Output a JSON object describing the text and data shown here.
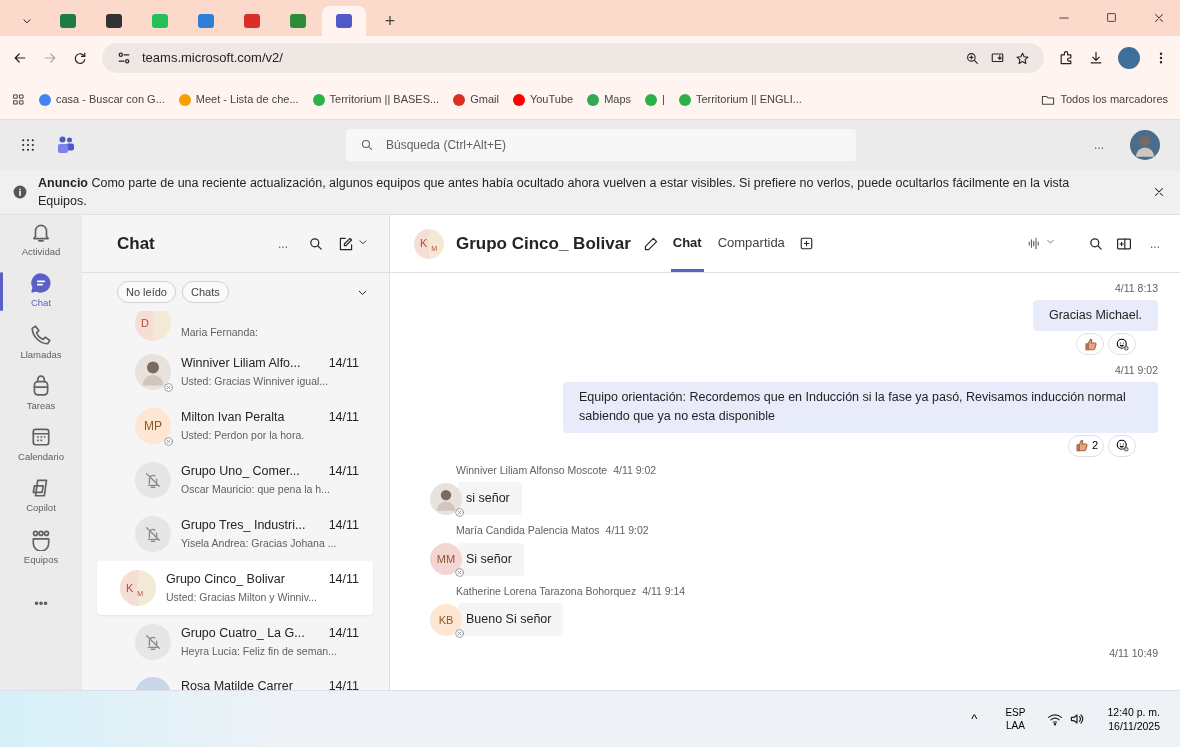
{
  "browser": {
    "tabs": [
      {
        "color": "#1e7b45",
        "selected": false
      },
      {
        "color": "#333333",
        "selected": false
      },
      {
        "color": "#25c05a",
        "selected": false
      },
      {
        "color": "#2f7fd8",
        "selected": false
      },
      {
        "color": "#d93025",
        "selected": false
      },
      {
        "color": "#2e8b3a",
        "selected": false
      },
      {
        "color": "#5059c9",
        "selected": true
      }
    ],
    "new_tab": "+",
    "address": "teams.microsoft.com/v2/",
    "bookmarks": [
      {
        "label": "casa - Buscar con G...",
        "color": "#4285f4"
      },
      {
        "label": "Meet - Lista de che...",
        "color": "#f4a100"
      },
      {
        "label": "Territorium || BASES...",
        "color": "#2db24a"
      },
      {
        "label": "Gmail",
        "color": "#d93025"
      },
      {
        "label": "YouTube",
        "color": "#ff0000"
      },
      {
        "label": "Maps",
        "color": "#34a853"
      },
      {
        "label": "|",
        "color": "#2db24a"
      },
      {
        "label": "Territorium || ENGLI...",
        "color": "#2db24a"
      }
    ],
    "all_bookmarks": "Todos los marcadores"
  },
  "teams": {
    "search": {
      "placeholder": "Búsqueda (Ctrl+Alt+E)"
    },
    "more": "...",
    "banner": {
      "title": "Anuncio",
      "text": "Como parte de una reciente actualización, algunos equipos que antes había ocultado ahora vuelven a estar visibles. Si prefiere no verlos, puede ocultarlos fácilmente en la vista Equipos."
    },
    "rail": [
      {
        "label": "Actividad",
        "kind": "bell",
        "selected": false
      },
      {
        "label": "Chat",
        "kind": "chat",
        "selected": true
      },
      {
        "label": "Llamadas",
        "kind": "phone",
        "selected": false
      },
      {
        "label": "Tareas",
        "kind": "bag",
        "selected": false
      },
      {
        "label": "Calendario",
        "kind": "calendar",
        "selected": false
      },
      {
        "label": "Copilot",
        "kind": "copilot",
        "selected": false
      },
      {
        "label": "Equipos",
        "kind": "teams",
        "selected": false
      }
    ],
    "rail_more": "•••",
    "chat_list": {
      "title": "Chat",
      "more": "...",
      "filters": [
        "No leído",
        "Chats"
      ],
      "items": [
        {
          "avatar": {
            "kind": "group",
            "initials": "D"
          },
          "preview": "Maria Fernanda:",
          "selected": false
        },
        {
          "avatar": {
            "kind": "photo"
          },
          "name": "Winniver Liliam Alfo...",
          "time": "14/11",
          "preview": "Usted: Gracias Winniver igual...",
          "selected": false
        },
        {
          "avatar": {
            "kind": "initials",
            "initials": "MP"
          },
          "name": "Milton Ivan Peralta",
          "time": "14/11",
          "preview": "Usted: Perdon por la hora.",
          "selected": false
        },
        {
          "avatar": {
            "kind": "muted"
          },
          "name": "Grupo Uno_ Comer...",
          "time": "14/11",
          "preview": "Oscar Mauricio: que pena la h...",
          "selected": false
        },
        {
          "avatar": {
            "kind": "muted"
          },
          "name": "Grupo Tres_ Industri...",
          "time": "14/11",
          "preview": "Yisela Andrea: Gracias Johana ...",
          "selected": false
        },
        {
          "avatar": {
            "kind": "group",
            "initials": "K",
            "initials2": "M"
          },
          "name": "Grupo Cinco_ Bolivar",
          "time": "14/11",
          "preview": "Usted: Gracias Milton y Winniv...",
          "selected": true
        },
        {
          "avatar": {
            "kind": "muted"
          },
          "name": "Grupo Cuatro_ La G...",
          "time": "14/11",
          "preview": "Heyra Lucia: Feliz fin de seman...",
          "selected": false
        },
        {
          "avatar": {
            "kind": "blank"
          },
          "name": "Rosa Matilde Carrer",
          "time": "14/11",
          "selected": false
        }
      ]
    },
    "conversation": {
      "initials": "K",
      "initials2": "M",
      "title": "Grupo Cinco_ Bolivar",
      "tabs": [
        {
          "label": "Chat",
          "selected": true
        },
        {
          "label": "Compartida",
          "selected": false
        }
      ],
      "messages": [
        {
          "kind": "outgoing",
          "time": "4/11 8:13",
          "text": "Gracias Michael."
        },
        {
          "kind": "outgoing",
          "time": "4/11 9:02",
          "text": "Equipo orientación: Recordemos que en Inducción si la fase ya pasó, Revisamos inducción normal sabiendo que ya no esta disponible",
          "reaction_count": "2"
        },
        {
          "kind": "incoming",
          "avatar": {
            "kind": "photo"
          },
          "sender": "Winniver Liliam Alfonso Moscote",
          "time": "4/11 9:02",
          "text": "si señor"
        },
        {
          "kind": "incoming",
          "avatar": {
            "kind": "initials",
            "initials": "MM",
            "color": "#f3d6d3"
          },
          "sender": "María Candida Palencia Matos",
          "time": "4/11 9:02",
          "text": "Si señor"
        },
        {
          "kind": "incoming",
          "avatar": {
            "kind": "initials",
            "initials": "KB",
            "color": "#fde7d2"
          },
          "sender": "Katherine Lorena Tarazona Bohorquez",
          "time": "4/11 9:14",
          "text": "Bueno Si señor"
        },
        {
          "kind": "timestamp",
          "time": "4/11 10:49"
        }
      ]
    }
  },
  "taskbar": {
    "caret": "^",
    "lang": "ESP",
    "layout": "LAA",
    "time": "12:40 p. m.",
    "date": "16/11/2025"
  }
}
